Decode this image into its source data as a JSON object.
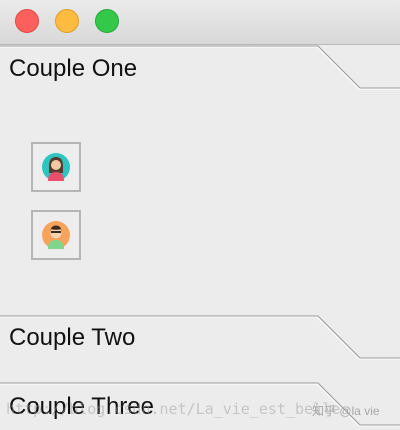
{
  "window": {
    "controls": [
      {
        "name": "close",
        "color": "#fc605c"
      },
      {
        "name": "minimize",
        "color": "#fdbc40"
      },
      {
        "name": "maximize",
        "color": "#34c84a"
      }
    ]
  },
  "accordion": {
    "panes": [
      {
        "title": "Couple One",
        "expanded": true,
        "items": [
          {
            "icon": "female-avatar-icon",
            "color": "#2ec4c0"
          },
          {
            "icon": "male-avatar-icon",
            "color": "#f7a35c"
          }
        ]
      },
      {
        "title": "Couple Two",
        "expanded": false
      },
      {
        "title": "Couple Three",
        "expanded": false
      }
    ]
  },
  "watermark": {
    "url_text": "http://blog.csdn.net/La_vie_est_belle",
    "site_text": "知乎 @la vie"
  }
}
